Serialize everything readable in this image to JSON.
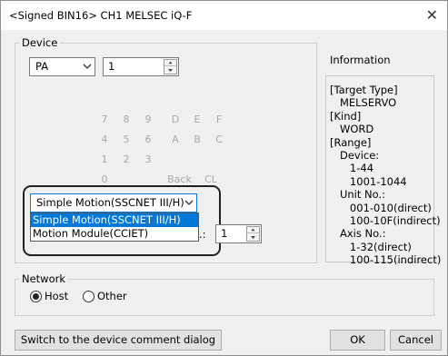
{
  "window": {
    "title": "<Signed BIN16> CH1 MELSEC iQ-F",
    "close_glyph": "✕"
  },
  "device": {
    "group_label": "Device",
    "type_value": "PA",
    "number_value": "1",
    "keypad": [
      "7",
      "8",
      "9",
      "D",
      "E",
      "F",
      "4",
      "5",
      "6",
      "A",
      "B",
      "C",
      "1",
      "2",
      "3",
      "0",
      "Back",
      "CL"
    ],
    "module_combo_value": "Simple Motion(SSCNET III/H)",
    "module_options": [
      "Simple Motion(SSCNET III/H)",
      "Motion Module(CCIET)"
    ],
    "unit_label_tail": ".:",
    "unit_value": "1"
  },
  "information": {
    "label": "Information",
    "lines": [
      "[Target Type]",
      "   MELSERVO",
      "[Kind]",
      "   WORD",
      "[Range]",
      "   Device:",
      "      1-44",
      "      1001-1044",
      "   Unit No.:",
      "      001-010(direct)",
      "      100-10F(indirect)",
      "   Axis No.:",
      "      1-32(direct)",
      "      100-115(indirect)"
    ]
  },
  "network": {
    "group_label": "Network",
    "options": [
      {
        "label": "Host",
        "selected": true
      },
      {
        "label": "Other",
        "selected": false
      }
    ]
  },
  "buttons": {
    "switch_label": "Switch to the device comment dialog",
    "ok_label": "OK",
    "cancel_label": "Cancel"
  },
  "colors": {
    "selection": "#0078d7",
    "disabled_text": "#a9a9a9"
  }
}
